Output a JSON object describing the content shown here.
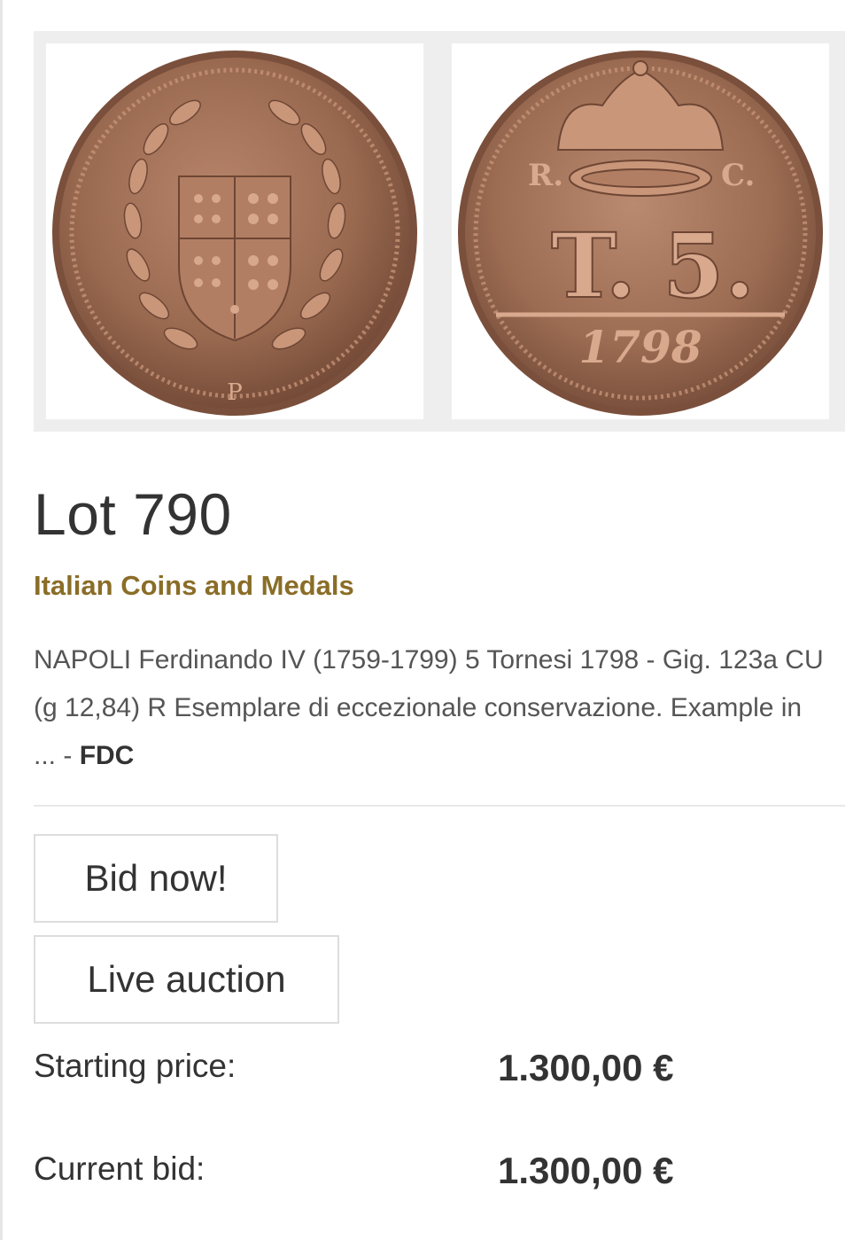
{
  "lot": {
    "title": "Lot 790",
    "category": "Italian Coins and Medals",
    "description": "NAPOLI Ferdinando IV (1759-1799) 5 Tornesi 1798 - Gig. 123a CU (g 12,84) R Esemplare di eccezionale conservazione. Example in ...",
    "description_separator": " - ",
    "grade": "FDC"
  },
  "coin": {
    "obverse_mintmark": "P",
    "reverse_left_letter": "R.",
    "reverse_right_letter": "C.",
    "reverse_denomination_t": "T.",
    "reverse_denomination_5": "5.",
    "reverse_year": "1798"
  },
  "buttons": {
    "bid_now": "Bid now!",
    "live_auction": "Live auction"
  },
  "prices": {
    "starting_label": "Starting price:",
    "starting_value": "1.300,00 €",
    "current_label": "Current bid:",
    "current_value": "1.300,00 €"
  },
  "colors": {
    "category": "#8a6d27",
    "coin_copper": "#9a6a50",
    "coin_dark": "#6e4634",
    "coin_highlight": "#c9967a"
  }
}
